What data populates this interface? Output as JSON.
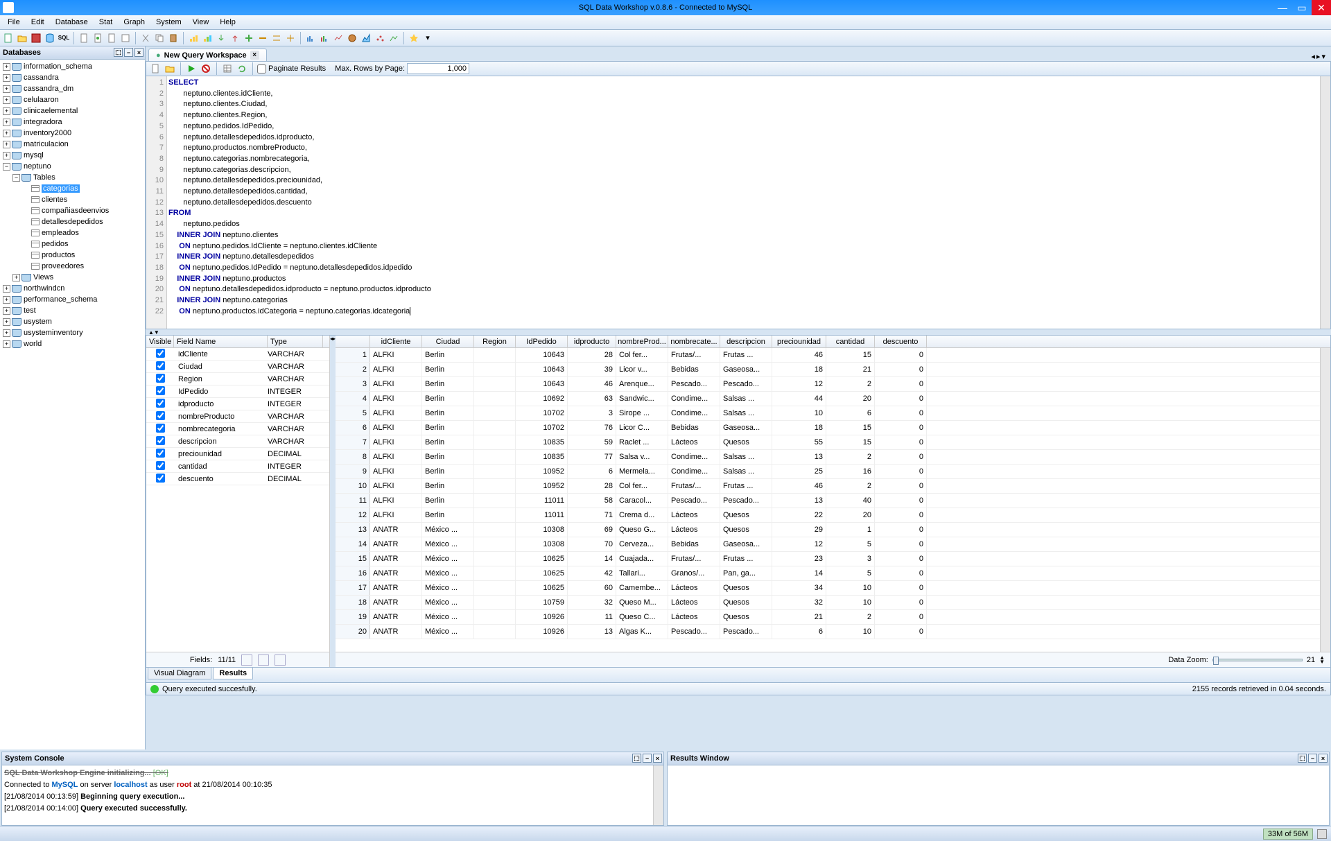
{
  "app": {
    "title": "SQL Data Workshop v.0.8.6 - Connected to MySQL"
  },
  "menu": [
    "File",
    "Edit",
    "Database",
    "Stat",
    "Graph",
    "System",
    "View",
    "Help"
  ],
  "sidebar": {
    "title": "Databases",
    "dbs": [
      "information_schema",
      "cassandra",
      "cassandra_dm",
      "celulaaron",
      "clinicaelemental",
      "integradora",
      "inventory2000",
      "matriculacion",
      "mysql",
      "neptuno"
    ],
    "neptuno_tables": [
      "categorias",
      "clientes",
      "compañiasdeenvios",
      "detallesdepedidos",
      "empleados",
      "pedidos",
      "productos",
      "proveedores"
    ],
    "views_label": "Views",
    "tables_label": "Tables",
    "dbs2": [
      "northwindcn",
      "performance_schema",
      "test",
      "usystem",
      "usysteminventory",
      "world"
    ]
  },
  "tab": {
    "label": "New Query Workspace"
  },
  "qtb": {
    "paginate": "Paginate Results",
    "maxrows_label": "Max. Rows by Page:",
    "maxrows": "1,000"
  },
  "sql": {
    "l1": "SELECT",
    "cols": [
      "neptuno.clientes.idCliente,",
      "neptuno.clientes.Ciudad,",
      "neptuno.clientes.Region,",
      "neptuno.pedidos.IdPedido,",
      "neptuno.detallesdepedidos.idproducto,",
      "neptuno.productos.nombreProducto,",
      "neptuno.categorias.nombrecategoria,",
      "neptuno.categorias.descripcion,",
      "neptuno.detallesdepedidos.preciounidad,",
      "neptuno.detallesdepedidos.cantidad,",
      "neptuno.detallesdepedidos.descuento"
    ],
    "from": "FROM",
    "from_tbl": "neptuno.pedidos",
    "joins": [
      {
        "j": "INNER JOIN",
        "t": "neptuno.clientes",
        "on": "ON",
        "c": "neptuno.pedidos.IdCliente = neptuno.clientes.idCliente"
      },
      {
        "j": "INNER JOIN",
        "t": "neptuno.detallesdepedidos",
        "on": "ON",
        "c": "neptuno.pedidos.IdPedido = neptuno.detallesdepedidos.idpedido"
      },
      {
        "j": "INNER JOIN",
        "t": "neptuno.productos",
        "on": "ON",
        "c": "neptuno.detallesdepedidos.idproducto = neptuno.productos.idproducto"
      },
      {
        "j": "INNER JOIN",
        "t": "neptuno.categorias",
        "on": "ON",
        "c": "neptuno.productos.idCategoria = neptuno.categorias.idcategoria"
      }
    ]
  },
  "fields": {
    "hdr": {
      "v": "Visible",
      "fn": "Field Name",
      "t": "Type"
    },
    "rows": [
      {
        "n": "idCliente",
        "t": "VARCHAR"
      },
      {
        "n": "Ciudad",
        "t": "VARCHAR"
      },
      {
        "n": "Region",
        "t": "VARCHAR"
      },
      {
        "n": "IdPedido",
        "t": "INTEGER"
      },
      {
        "n": "idproducto",
        "t": "INTEGER"
      },
      {
        "n": "nombreProducto",
        "t": "VARCHAR"
      },
      {
        "n": "nombrecategoria",
        "t": "VARCHAR"
      },
      {
        "n": "descripcion",
        "t": "VARCHAR"
      },
      {
        "n": "preciounidad",
        "t": "DECIMAL"
      },
      {
        "n": "cantidad",
        "t": "INTEGER"
      },
      {
        "n": "descuento",
        "t": "DECIMAL"
      }
    ],
    "footer": {
      "label": "Fields:",
      "count": "11/11"
    }
  },
  "grid": {
    "cols": [
      "idCliente",
      "Ciudad",
      "Region",
      "IdPedido",
      "idproducto",
      "nombreProd...",
      "nombrecate...",
      "descripcion",
      "preciounidad",
      "cantidad",
      "descuento"
    ],
    "rows": [
      {
        "n": 1,
        "c": [
          "ALFKI",
          "Berlin",
          "",
          "10643",
          "28",
          "Col fer...",
          "Frutas/...",
          "Frutas ...",
          "46",
          "15",
          "0"
        ]
      },
      {
        "n": 2,
        "c": [
          "ALFKI",
          "Berlin",
          "",
          "10643",
          "39",
          "Licor v...",
          "Bebidas",
          "Gaseosa...",
          "18",
          "21",
          "0"
        ]
      },
      {
        "n": 3,
        "c": [
          "ALFKI",
          "Berlin",
          "",
          "10643",
          "46",
          "Arenque...",
          "Pescado...",
          "Pescado...",
          "12",
          "2",
          "0"
        ]
      },
      {
        "n": 4,
        "c": [
          "ALFKI",
          "Berlin",
          "",
          "10692",
          "63",
          "Sandwic...",
          "Condime...",
          "Salsas ...",
          "44",
          "20",
          "0"
        ]
      },
      {
        "n": 5,
        "c": [
          "ALFKI",
          "Berlin",
          "",
          "10702",
          "3",
          "Sirope ...",
          "Condime...",
          "Salsas ...",
          "10",
          "6",
          "0"
        ]
      },
      {
        "n": 6,
        "c": [
          "ALFKI",
          "Berlin",
          "",
          "10702",
          "76",
          "Licor C...",
          "Bebidas",
          "Gaseosa...",
          "18",
          "15",
          "0"
        ]
      },
      {
        "n": 7,
        "c": [
          "ALFKI",
          "Berlin",
          "",
          "10835",
          "59",
          "Raclet ...",
          "Lácteos",
          "Quesos",
          "55",
          "15",
          "0"
        ]
      },
      {
        "n": 8,
        "c": [
          "ALFKI",
          "Berlin",
          "",
          "10835",
          "77",
          "Salsa v...",
          "Condime...",
          "Salsas ...",
          "13",
          "2",
          "0"
        ]
      },
      {
        "n": 9,
        "c": [
          "ALFKI",
          "Berlin",
          "",
          "10952",
          "6",
          "Mermela...",
          "Condime...",
          "Salsas ...",
          "25",
          "16",
          "0"
        ]
      },
      {
        "n": 10,
        "c": [
          "ALFKI",
          "Berlin",
          "",
          "10952",
          "28",
          "Col fer...",
          "Frutas/...",
          "Frutas ...",
          "46",
          "2",
          "0"
        ]
      },
      {
        "n": 11,
        "c": [
          "ALFKI",
          "Berlin",
          "",
          "11011",
          "58",
          "Caracol...",
          "Pescado...",
          "Pescado...",
          "13",
          "40",
          "0"
        ]
      },
      {
        "n": 12,
        "c": [
          "ALFKI",
          "Berlin",
          "",
          "11011",
          "71",
          "Crema d...",
          "Lácteos",
          "Quesos",
          "22",
          "20",
          "0"
        ]
      },
      {
        "n": 13,
        "c": [
          "ANATR",
          "México ...",
          "",
          "10308",
          "69",
          "Queso G...",
          "Lácteos",
          "Quesos",
          "29",
          "1",
          "0"
        ]
      },
      {
        "n": 14,
        "c": [
          "ANATR",
          "México ...",
          "",
          "10308",
          "70",
          "Cerveza...",
          "Bebidas",
          "Gaseosa...",
          "12",
          "5",
          "0"
        ]
      },
      {
        "n": 15,
        "c": [
          "ANATR",
          "México ...",
          "",
          "10625",
          "14",
          "Cuajada...",
          "Frutas/...",
          "Frutas ...",
          "23",
          "3",
          "0"
        ]
      },
      {
        "n": 16,
        "c": [
          "ANATR",
          "México ...",
          "",
          "10625",
          "42",
          "Tallari...",
          "Granos/...",
          "Pan, ga...",
          "14",
          "5",
          "0"
        ]
      },
      {
        "n": 17,
        "c": [
          "ANATR",
          "México ...",
          "",
          "10625",
          "60",
          "Camembe...",
          "Lácteos",
          "Quesos",
          "34",
          "10",
          "0"
        ]
      },
      {
        "n": 18,
        "c": [
          "ANATR",
          "México ...",
          "",
          "10759",
          "32",
          "Queso M...",
          "Lácteos",
          "Quesos",
          "32",
          "10",
          "0"
        ]
      },
      {
        "n": 19,
        "c": [
          "ANATR",
          "México ...",
          "",
          "10926",
          "11",
          "Queso C...",
          "Lácteos",
          "Quesos",
          "21",
          "2",
          "0"
        ]
      },
      {
        "n": 20,
        "c": [
          "ANATR",
          "México ...",
          "",
          "10926",
          "13",
          "Algas K...",
          "Pescado...",
          "Pescado...",
          "6",
          "10",
          "0"
        ]
      }
    ],
    "zoom_label": "Data Zoom:",
    "zoom_val": "21"
  },
  "btabs": {
    "vd": "Visual Diagram",
    "res": "Results"
  },
  "status": {
    "msg": "Query executed succesfully.",
    "rt": "2155 records retrieved in 0.04 seconds."
  },
  "console": {
    "title": "System Console",
    "l0a": "SQL Data Workshop Engine initializing... ",
    "l0b": "[OK]",
    "l1a": "Connected to ",
    "l1b": "MySQL",
    "l1c": " on server ",
    "l1d": "localhost",
    "l1e": " as user ",
    "l1f": "root",
    "l1g": " at ",
    "l1h": "21/08/2014 00:10:35",
    "l2a": "[21/08/2014 00:13:59] ",
    "l2b": "Beginning query execution...",
    "l3a": "[21/08/2014 00:14:00] ",
    "l3b": "Query executed successfully."
  },
  "results_panel": "Results Window",
  "statusbar": {
    "mem": "33M of 56M"
  }
}
